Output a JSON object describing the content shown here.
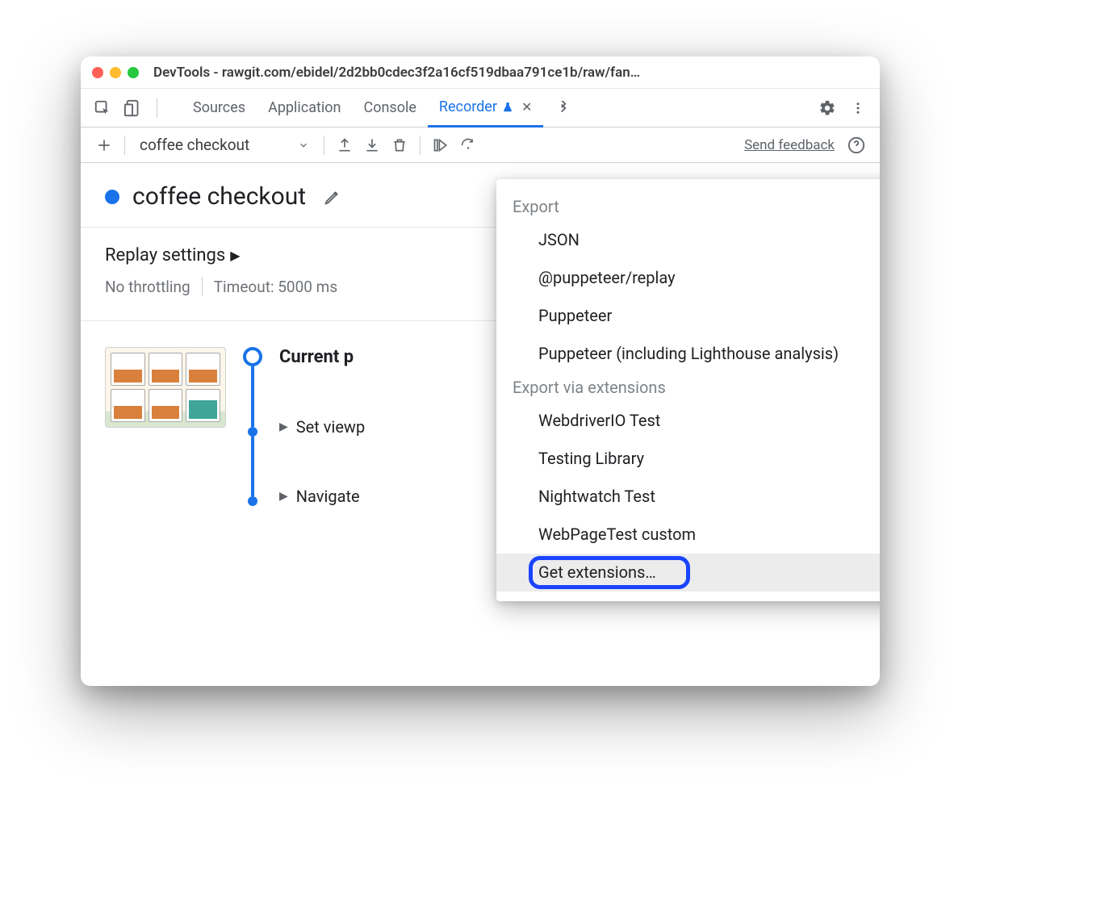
{
  "window": {
    "title": "DevTools - rawgit.com/ebidel/2d2bb0cdec3f2a16cf519dbaa791ce1b/raw/fan…"
  },
  "tabs": {
    "items": [
      "Sources",
      "Application",
      "Console",
      "Recorder"
    ],
    "active_index": 3
  },
  "toolbar": {
    "recording_name": "coffee checkout",
    "send_feedback": "Send feedback"
  },
  "recording": {
    "title": "coffee checkout"
  },
  "replay": {
    "title": "Replay settings",
    "throttling": "No throttling",
    "timeout": "Timeout: 5000 ms"
  },
  "steps": {
    "current": "Current p",
    "items": [
      "Set viewp",
      "Navigate"
    ]
  },
  "dropdown": {
    "header1": "Export",
    "group1": [
      "JSON",
      "@puppeteer/replay",
      "Puppeteer",
      "Puppeteer (including Lighthouse analysis)"
    ],
    "header2": "Export via extensions",
    "group2": [
      "WebdriverIO Test",
      "Testing Library",
      "Nightwatch Test",
      "WebPageTest custom",
      "Get extensions…"
    ]
  }
}
